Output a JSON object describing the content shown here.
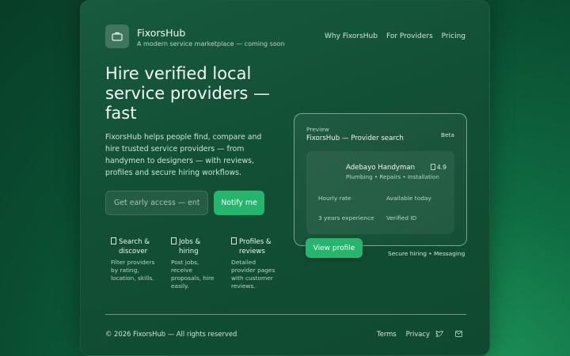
{
  "brand": {
    "name": "FixorsHub",
    "tagline": "A modern service marketplace — coming soon"
  },
  "nav": {
    "items": [
      "Why FixorsHub",
      "For Providers",
      "Pricing"
    ]
  },
  "hero": {
    "title": "Hire verified local service providers — fast",
    "description": "FixorsHub helps people find, compare and hire trusted service providers — from handymen to designers — with reviews, profiles and secure hiring workflows."
  },
  "signup": {
    "placeholder": "Get early access — enter",
    "button_label": "Notify me"
  },
  "features": [
    {
      "icon": "search-icon",
      "title": "Search & discover",
      "desc": "Filter providers by rating, location, skills."
    },
    {
      "icon": "briefcase-icon",
      "title": "Jobs & hiring",
      "desc": "Post jobs, receive proposals, hire easily."
    },
    {
      "icon": "profile-icon",
      "title": "Profiles & reviews",
      "desc": "Detailed provider pages with customer reviews."
    }
  ],
  "preview": {
    "label": "Preview",
    "title": "FixorsHub — Provider search",
    "badge": "Beta",
    "provider": {
      "name": "Adebayo Handyman",
      "tags": "Plumbing • Repairs • Installation",
      "rating": "4.9",
      "rate_label": "Hourly rate",
      "availability": "Available today",
      "experience": "3 years experience",
      "verified": "Verified ID"
    },
    "button_label": "View profile",
    "footnote": "Secure hiring • Messaging"
  },
  "footer": {
    "copyright": "© 2026 FixorsHub — All rights reserved",
    "links": [
      "Terms",
      "Privacy"
    ],
    "social_icons": [
      "twitter-icon",
      "email-icon"
    ]
  },
  "colors": {
    "accent": "#24b66c",
    "background": "#0a4d31",
    "card": "#175a3d"
  }
}
